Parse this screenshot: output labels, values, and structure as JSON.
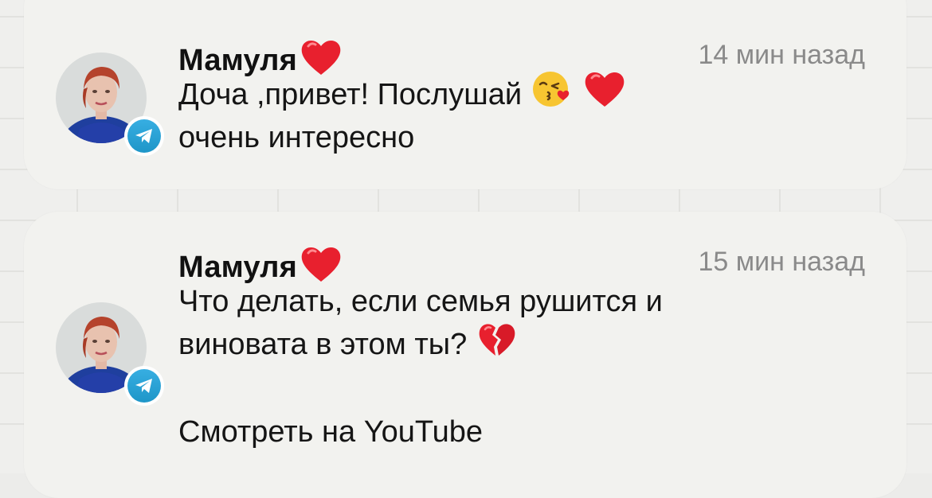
{
  "notifications": [
    {
      "sender": "Мамуля",
      "time": "14 мин назад",
      "lines": [
        "Доча ,привет! Послушай",
        "очень интересно"
      ],
      "icons": [
        "red-heart-icon",
        "kissing-face-icon",
        "red-heart-icon",
        "telegram-icon"
      ]
    },
    {
      "sender": "Мамуля",
      "time": "15 мин назад",
      "lines": [
        "Что делать, если семья рушится и",
        "виновата в этом ты?"
      ],
      "link": "Смотреть на YouTube",
      "icons": [
        "red-heart-icon",
        "broken-heart-icon",
        "telegram-icon"
      ]
    }
  ],
  "colors": {
    "background": "#efefed",
    "card": "#f2f2ef",
    "text": "#151515",
    "time": "#8a8a8a",
    "heart": "#e8202e",
    "telegram": "#2aa3dc"
  }
}
